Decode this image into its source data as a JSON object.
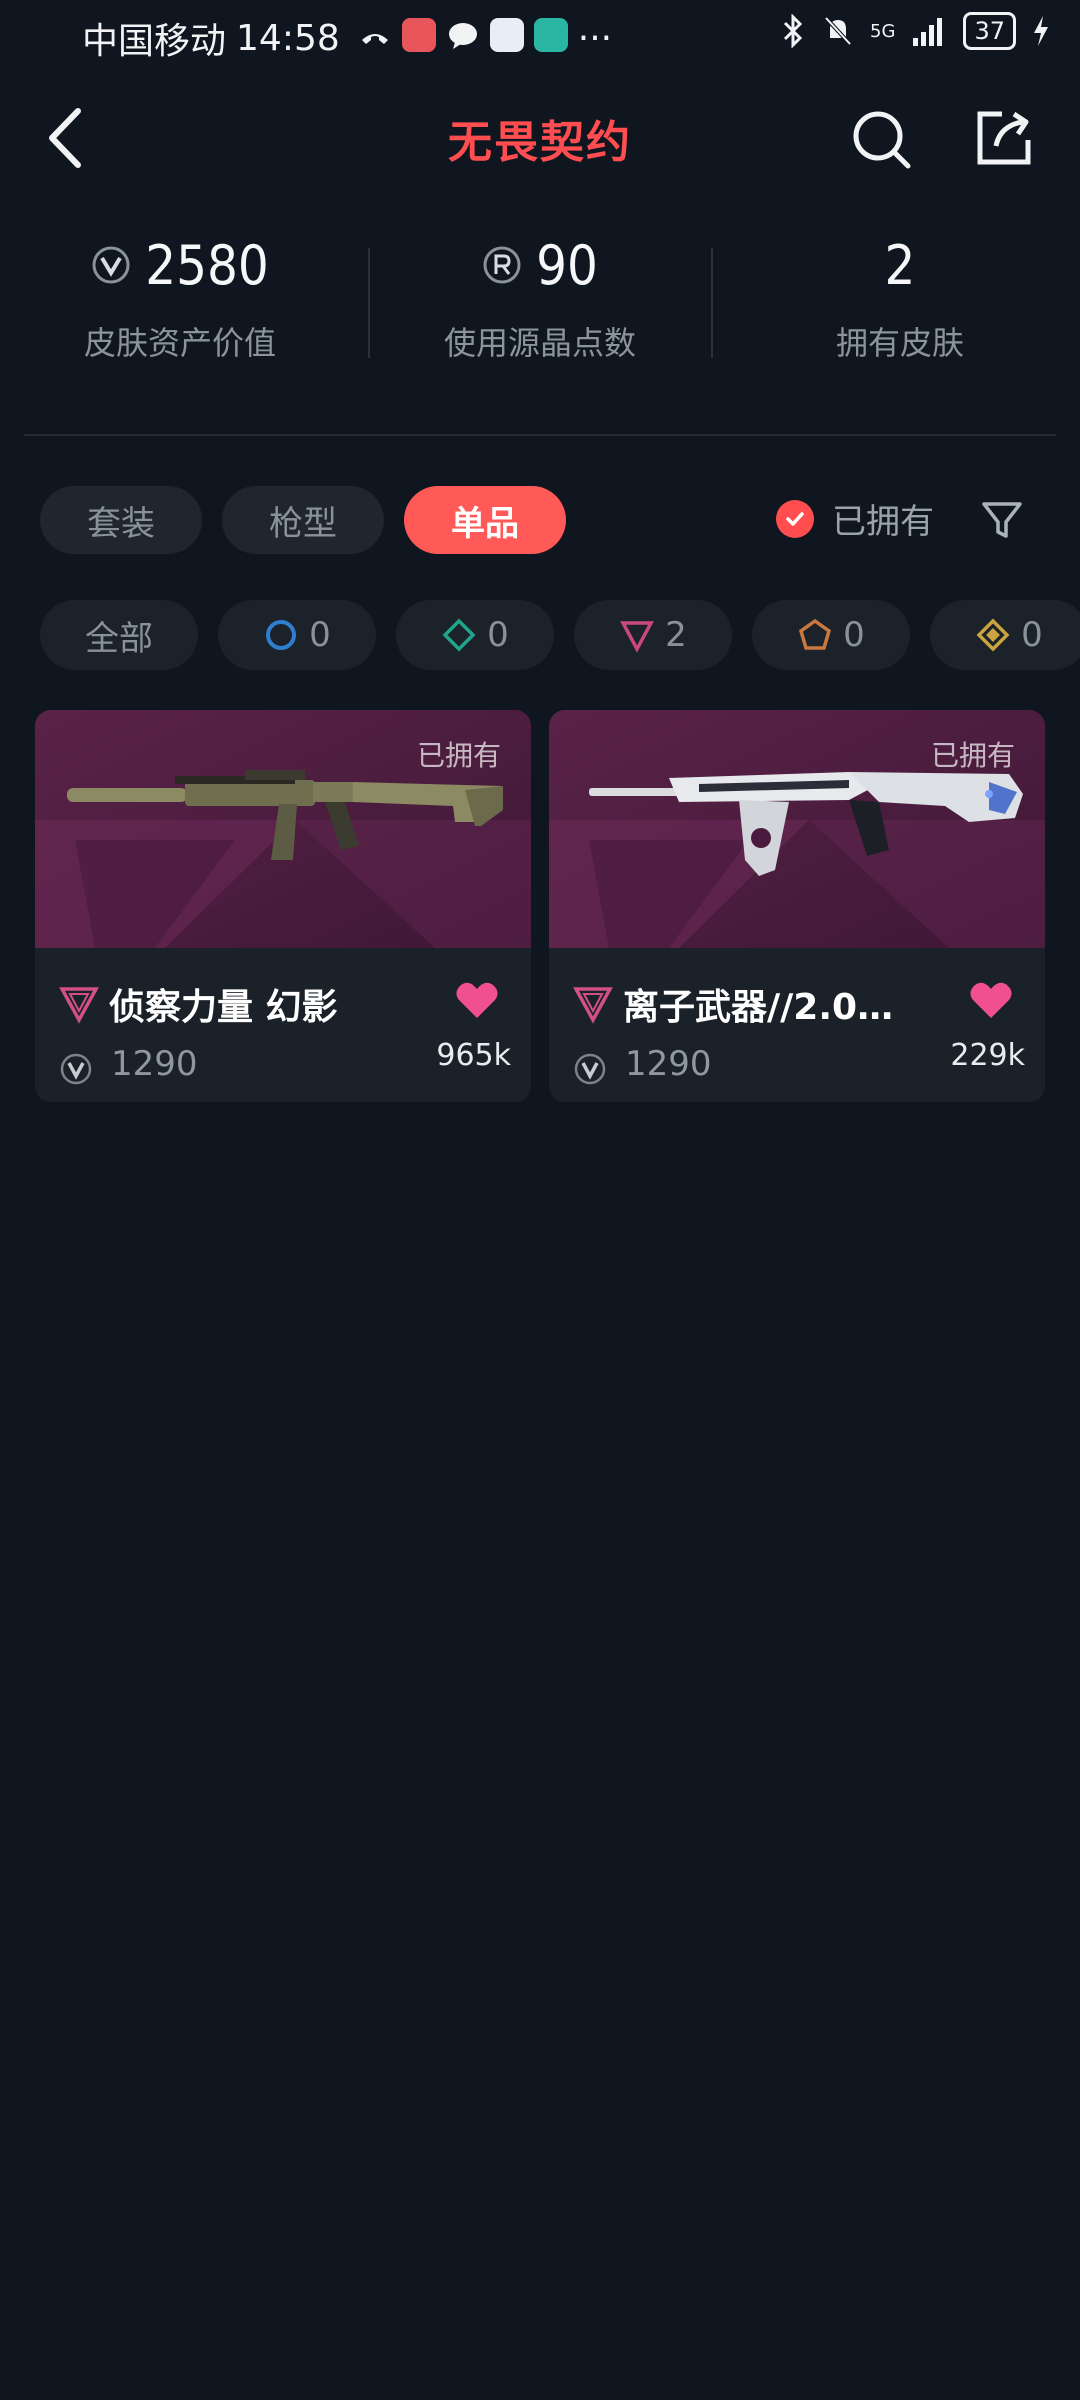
{
  "status_bar": {
    "carrier": "中国移动",
    "time": "14:58",
    "more": "···",
    "network": "5G",
    "battery": "37"
  },
  "header": {
    "brand": "无畏契约"
  },
  "stats": [
    {
      "value": "2580",
      "label": "皮肤资产价值",
      "icon": "vp-coin-icon"
    },
    {
      "value": "90",
      "label": "使用源晶点数",
      "icon": "radianite-icon"
    },
    {
      "value": "2",
      "label": "拥有皮肤",
      "icon": ""
    }
  ],
  "tabs": [
    {
      "label": "套装",
      "active": false
    },
    {
      "label": "枪型",
      "active": false
    },
    {
      "label": "单品",
      "active": true
    }
  ],
  "owned_filter": {
    "label": "已拥有",
    "checked": true
  },
  "rarity_chips": [
    {
      "label": "全部",
      "icon": ""
    },
    {
      "label": "0",
      "icon": "select-tier-icon",
      "color": "#2f7fcf"
    },
    {
      "label": "0",
      "icon": "deluxe-tier-icon",
      "color": "#1fa58a"
    },
    {
      "label": "2",
      "icon": "premium-tier-icon",
      "color": "#c9487f"
    },
    {
      "label": "0",
      "icon": "exclusive-tier-icon",
      "color": "#c9783f"
    },
    {
      "label": "0",
      "icon": "ultra-tier-icon",
      "color": "#c9a43f"
    }
  ],
  "cards": [
    {
      "name": "侦察力量 幻影",
      "price": "1290",
      "likes": "965k",
      "owned": "已拥有"
    },
    {
      "name": "离子武器//2.0…",
      "price": "1290",
      "likes": "229k",
      "owned": "已拥有"
    }
  ],
  "colors": {
    "accent": "#ff5a57",
    "background": "#0f1620",
    "premium": "#c9487f",
    "heart": "#f0508f"
  }
}
